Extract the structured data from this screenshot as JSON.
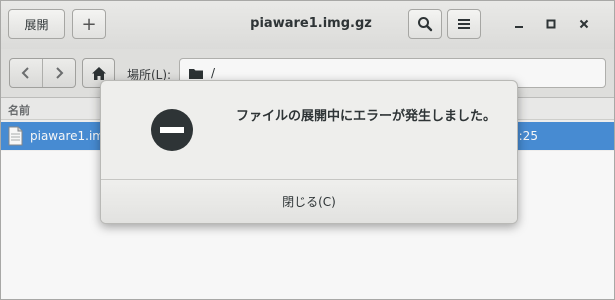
{
  "header": {
    "extract_label": "展開",
    "add_label": "+",
    "title": "piaware1.img.gz",
    "search_icon": "search-icon",
    "menu_icon": "hamburger-menu-icon",
    "minimize_label": "_",
    "maximize_label": "□",
    "close_label": "×"
  },
  "location": {
    "label": "場所(L):",
    "path": "/"
  },
  "list": {
    "columns": [
      "名前"
    ],
    "rows": [
      {
        "name": "piaware1.img",
        "modified_partial": "0:25",
        "selected": true
      }
    ]
  },
  "dialog": {
    "message": "ファイルの展開中にエラーが発生しました。",
    "close_label": "閉じる(C)",
    "icon": "error-stop-icon"
  },
  "colors": {
    "selection": "#4a90d9",
    "error_icon": "#2e3436"
  }
}
